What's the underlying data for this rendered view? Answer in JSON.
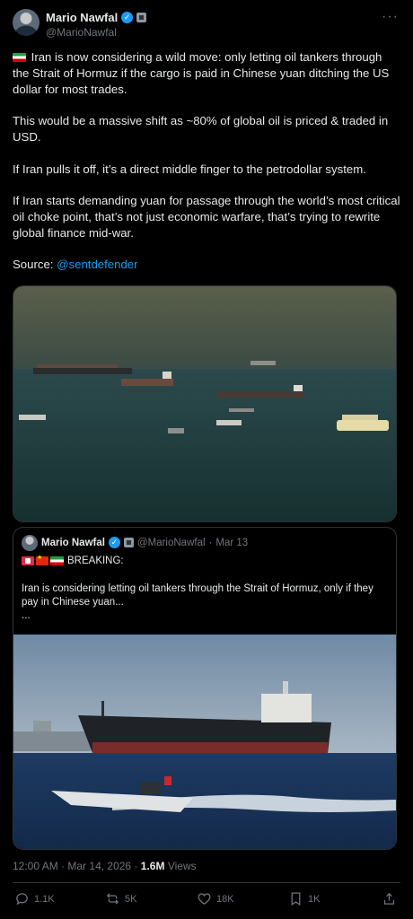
{
  "author": {
    "display_name": "Mario Nawfal",
    "handle": "@MarioNawfal",
    "avatar_icon": "avatar-portrait"
  },
  "tweet": {
    "paragraphs": [
      "Iran is now considering a wild move: only letting oil tankers through the Strait of Hormuz if the cargo is paid in Chinese yuan ditching the US dollar for most trades.",
      "This would be a massive shift as ~80% of global oil is priced & traded in USD.",
      "If Iran pulls it off, it’s a direct middle finger to the petrodollar system.",
      "If Iran starts demanding yuan for passage through the world’s most critical oil choke point, that’s not just economic warfare, that’s trying to rewrite global finance mid-war."
    ],
    "source_label": "Source: ",
    "source_link": "@sentdefender"
  },
  "quoted": {
    "display_name": "Mario Nawfal",
    "handle": "@MarioNawfal",
    "separator": "·",
    "date": "Mar 13",
    "breaking": "BREAKING:",
    "text": "Iran is considering letting oil tankers through the Strait of Hormuz, only if they pay in Chinese yuan...",
    "ellipsis": "..."
  },
  "meta": {
    "time": "12:00 AM",
    "dot": "·",
    "date": "Mar 14, 2026",
    "views_count": "1.6M",
    "views_label": "Views"
  },
  "actions": {
    "replies": "1.1K",
    "reposts": "5K",
    "likes": "18K",
    "bookmarks": "1K"
  },
  "colors": {
    "background": "#000000",
    "text": "#e7e9ea",
    "secondary": "#71767b",
    "accent": "#1d9bf0",
    "border": "#2f3336"
  }
}
